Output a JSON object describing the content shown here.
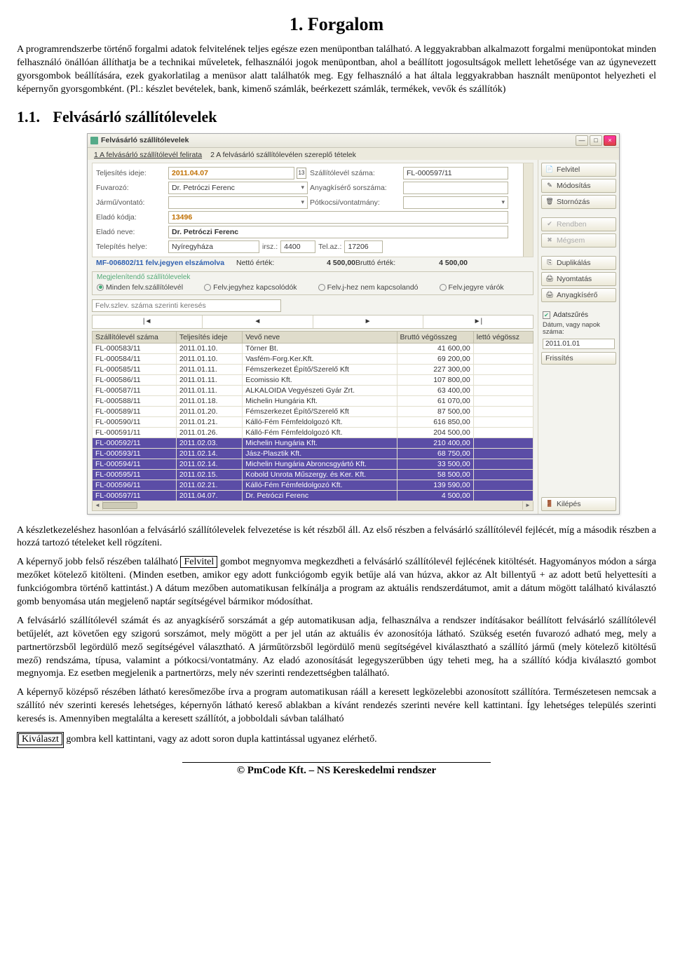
{
  "doc": {
    "h1": "1. Forgalom",
    "intro1": "A programrendszerbe történő forgalmi adatok felvitelének teljes egésze ezen menüpontban található. A leggyakrabban alkalmazott forgalmi menüpontokat minden felhasználó önállóan állíthatja be a technikai műveletek, felhasználói jogok menüpontban, ahol a beállított jogosultságok mellett lehetősége van az úgynevezett gyorsgombok beállítására, ezek gyakorlatilag a menüsor alatt találhatók meg. Egy felhasználó a hat általa leggyakrabban használt menüpontot helyezheti el képernyőn gyorsgombként. (Pl.: készlet bevételek, bank, kimenő számlák, beérkezett számlák, termékek, vevők és szállítók)",
    "section_num": "1.1.",
    "section_title": "Felvásárló szállítólevelek",
    "p_after1": "A készletkezeléshez hasonlóan a felvásárló szállítólevelek felvezetése is két részből áll. Az első részben a felvásárló szállítólevél fejlécét, míg a második részben a hozzá tartozó tételeket kell rögzíteni.",
    "p_after2_a": "A képernyő jobb felső részében található ",
    "felvitel_btn": "Felvitel",
    "p_after2_b": " gombot megnyomva megkezdheti a felvásárló szállítólevél fejlécének kitöltését. Hagyományos módon a sárga mezőket kötelező kitölteni. (Minden esetben, amikor egy adott funkciógomb egyik betűje alá van húzva, akkor az Alt billentyű + az adott betű helyettesíti a funkciógombra történő kattintást.) A dátum mezőben automatikusan felkínálja a program az aktuális rendszerdátumot, amit a dátum mögött található kiválasztó gomb benyomása után megjelenő naptár segítségével bármikor módosíthat.",
    "p_after3": "A felvásárló szállítólevél számát és az anyagkísérő sorszámát a gép automatikusan adja, felhasználva a rendszer indításakor beállított felvásárló szállítólevél betűjelét, azt követően egy szigorú sorszámot, mely mögött a per jel után az aktuális év azonosítója látható. Szükség esetén fuvarozó adható meg, mely a partnertörzsből legördülő mező segítségével választható. A járműtörzsből legördülő menü segítségével kiválasztható a szállító jármű (mely kötelező kitöltésű mező) rendszáma, típusa, valamint a pótkocsi/vontatmány. Az eladó azonosítását legegyszerűbben úgy teheti meg, ha a szállító kódja kiválasztó gombot megnyomja. Ez esetben megjelenik a partnertörzs, mely név szerinti rendezettségben található.",
    "p_after4_a": "A képernyő középső részében látható keresőmezőbe írva a program automatikusan rááll a keresett legközelebbi azonosított szállítóra. Természetesen nemcsak a szállító név szerinti keresés lehetséges, képernyőn látható kereső ablakban a kívánt rendezés szerinti nevére kell kattintani. Így lehetséges település szerinti keresés is. Amennyiben megtalálta a keresett szállítót, a jobboldali sávban található ",
    "kivalaszt_btn": "Kiválaszt",
    "p_after4_b": " gombra kell kattintani, vagy az adott soron dupla kattintással ugyanez elérhető."
  },
  "win": {
    "title": "Felvásárló szállítólevelek",
    "tab1": "1  A felvásárló szállítólevél felirata",
    "tab2": "2  A felvásárló szállítólevélen szereplő tételek",
    "form": {
      "l_teljesites": "Teljesítés ideje:",
      "v_teljesites": "2011.04.07",
      "date_icon": "13",
      "l_szallitolevel": "Szállítólevél száma:",
      "v_szallitolevel": "FL-000597/11",
      "l_fuvarozo": "Fuvarozó:",
      "v_fuvarozo": "Dr. Petróczi Ferenc",
      "l_anyagkisero": "Anyagkísérő sorszáma:",
      "l_jarmu": "Jármű/vontató:",
      "l_potkocsi": "Pótkocsi/vontatmány:",
      "l_elado_kodja": "Eladó kódja:",
      "v_elado_kodja": "13496",
      "l_elado_neve": "Eladó neve:",
      "v_elado_neve": "Dr. Petróczi Ferenc",
      "l_telepes": "Telepítés helye:",
      "v_telepes": "Nyíregyháza",
      "l_irsz": "irsz.:",
      "v_irsz": "4400",
      "l_telaz": "Tel.az.:",
      "v_telaz": "17206"
    },
    "summary": {
      "code": "MF-006802/11 felv.jegyen elszámolva",
      "netto_l": "Nettó érték:",
      "netto_v": "4 500,00",
      "brutto_l": "Bruttó érték:",
      "brutto_v": "4 500,00"
    },
    "filter": {
      "title": "Megjelenítendő szállítólevelek",
      "r1": "Minden felv.szállítólevél",
      "r2": "Felv.jegyhez kapcsolódók",
      "r3": "Felv.j-hez nem kapcsolandó",
      "r4": "Felv.jegyre várók"
    },
    "search_ph": "Felv.szlev. száma szerinti keresés",
    "nav": {
      "first": "|◄",
      "prev": "◄",
      "next": "►",
      "last": "►|"
    },
    "cols": {
      "c1": "Szállítólevél száma",
      "c2": "Teljesítés ideje",
      "c3": "Vevő neve",
      "c4": "Bruttó végösszeg",
      "c5": "lettó végössz"
    },
    "rows": [
      {
        "a": "FL-000583/11",
        "b": "2011.01.10.",
        "c": "Törner Bt.",
        "d": "41 600,00"
      },
      {
        "a": "FL-000584/11",
        "b": "2011.01.10.",
        "c": "Vasfém-Forg.Ker.Kft.",
        "d": "69 200,00"
      },
      {
        "a": "FL-000585/11",
        "b": "2011.01.11.",
        "c": "Fémszerkezet Építő/Szerelő Kft",
        "d": "227 300,00"
      },
      {
        "a": "FL-000586/11",
        "b": "2011.01.11.",
        "c": "Ecomissio Kft.",
        "d": "107 800,00"
      },
      {
        "a": "FL-000587/11",
        "b": "2011.01.11.",
        "c": "ALKALOIDA Vegyészeti Gyár Zrt.",
        "d": "63 400,00"
      },
      {
        "a": "FL-000588/11",
        "b": "2011.01.18.",
        "c": "Michelin Hungária Kft.",
        "d": "61 070,00"
      },
      {
        "a": "FL-000589/11",
        "b": "2011.01.20.",
        "c": "Fémszerkezet Építő/Szerelő Kft",
        "d": "87 500,00"
      },
      {
        "a": "FL-000590/11",
        "b": "2011.01.21.",
        "c": "Kálló-Fém Fémfeldolgozó Kft.",
        "d": "616 850,00"
      },
      {
        "a": "FL-000591/11",
        "b": "2011.01.26.",
        "c": "Kálló-Fém Fémfeldolgozó Kft.",
        "d": "204 500,00"
      },
      {
        "a": "FL-000592/11",
        "b": "2011.02.03.",
        "c": "Michelin Hungária Kft.",
        "d": "210 400,00",
        "sel": true
      },
      {
        "a": "FL-000593/11",
        "b": "2011.02.14.",
        "c": "Jász-Plasztik Kft.",
        "d": "68 750,00",
        "sel": true
      },
      {
        "a": "FL-000594/11",
        "b": "2011.02.14.",
        "c": "Michelin Hungária Abroncsgyártó Kft.",
        "d": "33 500,00",
        "sel": true
      },
      {
        "a": "FL-000595/11",
        "b": "2011.02.15.",
        "c": "Kobold Unrota Műszergy. és Ker. Kft.",
        "d": "58 500,00",
        "sel": true
      },
      {
        "a": "FL-000596/11",
        "b": "2011.02.21.",
        "c": "Kálló-Fém Fémfeldolgozó Kft.",
        "d": "139 590,00",
        "sel": true
      },
      {
        "a": "FL-000597/11",
        "b": "2011.04.07.",
        "c": "Dr. Petróczi Ferenc",
        "d": "4 500,00",
        "sel": true
      }
    ],
    "rbtn": {
      "felvitel": "Felvitel",
      "modositas": "Módosítás",
      "stornozas": "Stornózás",
      "rendben": "Rendben",
      "megsem": "Mégsem",
      "duplikalas": "Duplikálás",
      "nyomtatas": "Nyomtatás",
      "anyagkisero": "Anyagkísérő",
      "adatszures": "Adatszűrés",
      "datumtext": "Dátum, vagy napok száma:",
      "datum_v": "2011.01.01",
      "frissites": "Frissítés",
      "kilepes": "Kilépés"
    }
  },
  "footer": "© PmCode Kft. – NS Kereskedelmi rendszer"
}
